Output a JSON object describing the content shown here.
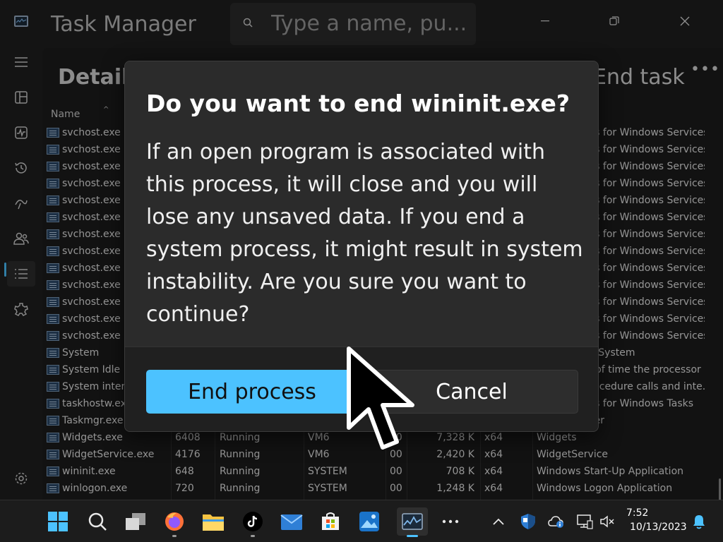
{
  "titlebar": {
    "title": "Task Manager",
    "search_placeholder": "Type a name, pu..."
  },
  "nav": {
    "items": [
      "hamburger-icon",
      "processes-icon",
      "performance-icon",
      "app-history-icon",
      "startup-apps-icon",
      "users-icon",
      "details-icon",
      "services-icon"
    ],
    "active": "details-icon",
    "settings_icon": "gear-icon"
  },
  "main": {
    "page_title": "Details",
    "end_task_label": "End task",
    "more_label": "•••",
    "column_name_header": "Name",
    "rows": [
      {
        "name": "svchost.exe",
        "desc": "Host Process for Windows Services"
      },
      {
        "name": "svchost.exe",
        "desc": "Host Process for Windows Services"
      },
      {
        "name": "svchost.exe",
        "desc": "Host Process for Windows Services"
      },
      {
        "name": "svchost.exe",
        "desc": "Host Process for Windows Services"
      },
      {
        "name": "svchost.exe",
        "desc": "Host Process for Windows Services"
      },
      {
        "name": "svchost.exe",
        "desc": "Host Process for Windows Services"
      },
      {
        "name": "svchost.exe",
        "desc": "Host Process for Windows Services"
      },
      {
        "name": "svchost.exe",
        "desc": "Host Process for Windows Services"
      },
      {
        "name": "svchost.exe",
        "desc": "Host Process for Windows Services"
      },
      {
        "name": "svchost.exe",
        "desc": "Host Process for Windows Services"
      },
      {
        "name": "svchost.exe",
        "desc": "Host Process for Windows Services"
      },
      {
        "name": "svchost.exe",
        "desc": "Host Process for Windows Services"
      },
      {
        "name": "svchost.exe",
        "desc": "Host Process for Windows Services"
      },
      {
        "name": "System",
        "desc": "NT Kernel & System"
      },
      {
        "name": "System Idle Process",
        "desc": "Percentage of time the processor ..."
      },
      {
        "name": "System interrupts",
        "desc": "Deferred procedure calls and inte..."
      },
      {
        "name": "taskhostw.exe",
        "desc": "Host Process for Windows Tasks"
      },
      {
        "name": "Taskmgr.exe",
        "desc": "Task Manager"
      },
      {
        "name": "Widgets.exe",
        "pid": "6408",
        "status": "Running",
        "user": "VM6",
        "cpu": "00",
        "mem": "7,328 K",
        "arch": "x64",
        "desc": "Widgets"
      },
      {
        "name": "WidgetService.exe",
        "pid": "4176",
        "status": "Running",
        "user": "VM6",
        "cpu": "00",
        "mem": "2,420 K",
        "arch": "x64",
        "desc": "WidgetService"
      },
      {
        "name": "wininit.exe",
        "pid": "648",
        "status": "Running",
        "user": "SYSTEM",
        "cpu": "00",
        "mem": "708 K",
        "arch": "x64",
        "desc": "Windows Start-Up Application"
      },
      {
        "name": "winlogon.exe",
        "pid": "720",
        "status": "Running",
        "user": "SYSTEM",
        "cpu": "00",
        "mem": "1,248 K",
        "arch": "x64",
        "desc": "Windows Logon Application"
      }
    ]
  },
  "dialog": {
    "title": "Do you want to end wininit.exe?",
    "body": "If an open program is associated with this process, it will close and you will lose any unsaved data. If you end a system process, it might result in system instability. Are you sure you want to continue?",
    "primary_label": "End process",
    "secondary_label": "Cancel"
  },
  "taskbar": {
    "apps": [
      "start-icon",
      "search-icon",
      "task-view-icon",
      "firefox-icon",
      "file-explorer-icon",
      "tiktok-icon",
      "mail-icon",
      "store-icon",
      "photos-icon",
      "task-manager-icon",
      "more-apps-icon"
    ],
    "clock_time": "7:52",
    "clock_date": "10/13/2023"
  },
  "colors": {
    "accent": "#4cc2ff",
    "background": "#202020",
    "dialog": "#2b2b2b"
  }
}
